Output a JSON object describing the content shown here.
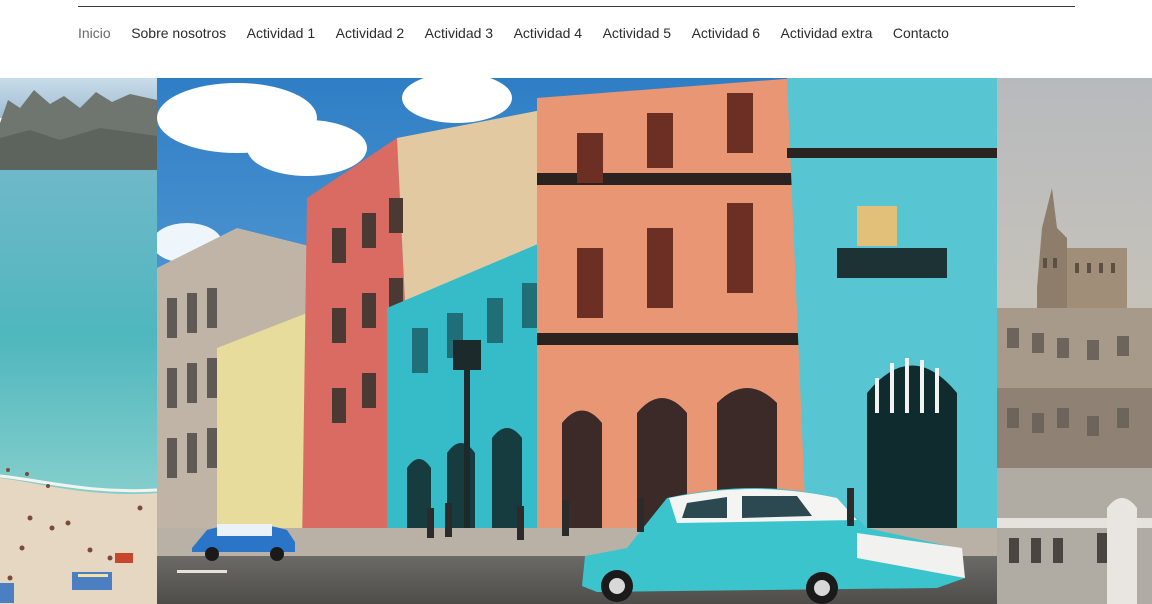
{
  "nav": {
    "items": [
      {
        "label": "Inicio",
        "active": true
      },
      {
        "label": "Sobre nosotros"
      },
      {
        "label": "Actividad 1"
      },
      {
        "label": "Actividad 2"
      },
      {
        "label": "Actividad 3"
      },
      {
        "label": "Actividad 4"
      },
      {
        "label": "Actividad 5"
      },
      {
        "label": "Actividad 6"
      },
      {
        "label": "Actividad extra"
      },
      {
        "label": "Contacto"
      }
    ]
  },
  "colors": {
    "nav_text": "#2c2c2c",
    "nav_active": "#6b6b6b",
    "divider": "#3a3a3a",
    "sky": "#3f86c9",
    "turquoise": "#35bcc8",
    "coral": "#e99674",
    "salmon": "#d96b62",
    "sea": "#4fb7be",
    "sand": "#e5d7c2",
    "city": "#a89a8a"
  },
  "gallery": {
    "slides": [
      "beach-photo",
      "havana-street-photo",
      "city-skyline-photo"
    ]
  }
}
